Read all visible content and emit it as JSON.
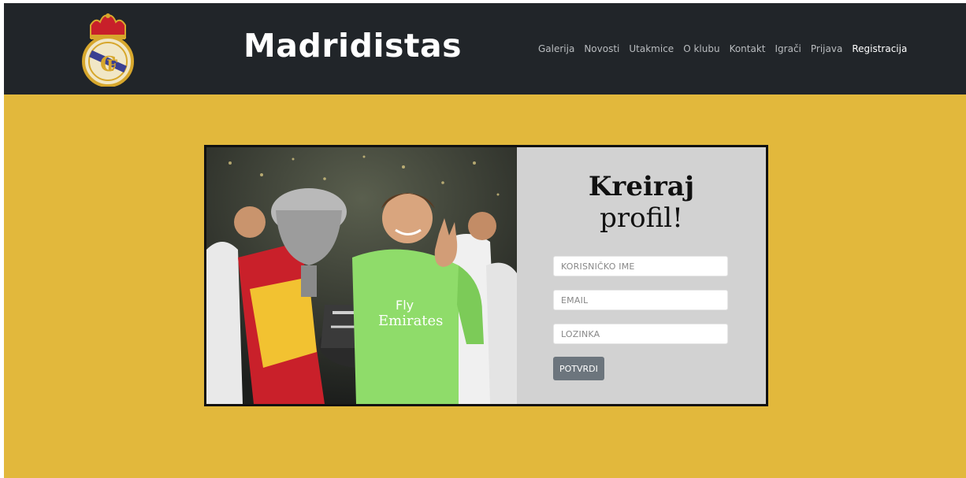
{
  "brand": {
    "name": "Madridistas"
  },
  "nav": {
    "items": [
      {
        "label": "Galerija"
      },
      {
        "label": "Novosti"
      },
      {
        "label": "Utakmice"
      },
      {
        "label": "O klubu"
      },
      {
        "label": "Kontakt"
      },
      {
        "label": "Igrači"
      },
      {
        "label": "Prijava"
      },
      {
        "label": "Registracija",
        "active": true
      }
    ]
  },
  "form": {
    "title_line1": "Kreiraj",
    "title_line2": "profil!",
    "username_placeholder": "KORISNIČKO IME",
    "email_placeholder": "EMAIL",
    "password_placeholder": "LOZINKA",
    "submit_label": "POTVRDI"
  },
  "photo": {
    "shirt_text_1": "Fly",
    "shirt_text_2": "Emirates"
  },
  "colors": {
    "navbar": "#212529",
    "page_bg": "#e2b83c",
    "button": "#6c757d",
    "form_panel": "#d2d2d2"
  }
}
